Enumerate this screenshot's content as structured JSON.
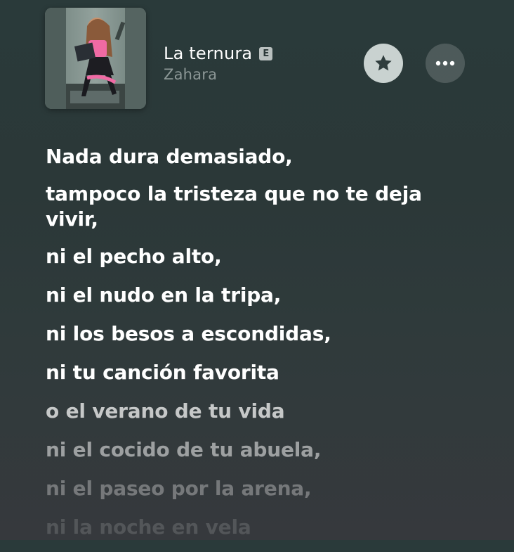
{
  "now_playing": {
    "title": "La ternura",
    "explicit_badge": "E",
    "artist": "Zahara",
    "artwork_icon": "album-artwork",
    "favorite_icon": "star-icon",
    "more_icon": "more-dots-icon"
  },
  "lyrics": {
    "lines": [
      "Nada dura demasiado,",
      "tampoco la tristeza que no te deja vivir,",
      "ni el pecho alto,",
      "ni el nudo en la tripa,",
      "ni los besos a escondidas,",
      "ni tu canción favorita",
      "o el verano de tu vida",
      "ni el cocido de tu abuela,",
      "ni el paseo por la arena,",
      "ni la noche en vela"
    ]
  },
  "colors": {
    "background": "#2b3838",
    "lyric_active": "#ffffff",
    "lyric_inactive": "#9aa4a3",
    "star_button": "#c9d2d0",
    "more_button": "#4b5656"
  }
}
